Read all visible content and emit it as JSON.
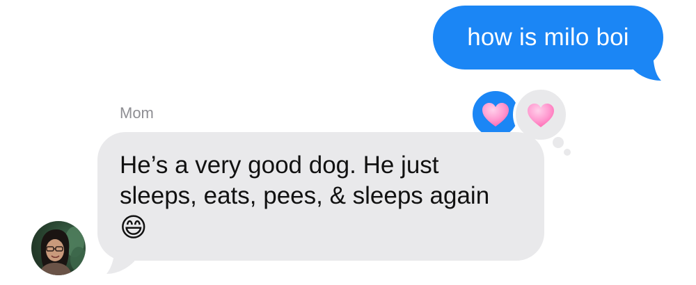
{
  "thread": {
    "outgoing_message": {
      "text": "how is milo boi",
      "bubble_color": "#1b86f5"
    },
    "incoming_message": {
      "sender": "Mom",
      "text": "He’s a very good dog. He just\nsleeps, eats, pees, & sleeps again",
      "emoji": "😄",
      "bubble_color": "#e9e9eb"
    },
    "tapbacks": [
      {
        "by": "me",
        "icon": "heart-icon",
        "color": "#ff8fc7",
        "background": "#1b86f5"
      },
      {
        "by": "them",
        "icon": "heart-icon",
        "color": "#ff8fc7",
        "background": "#e9e9eb"
      }
    ],
    "avatar": {
      "icon": "contact-photo"
    }
  }
}
